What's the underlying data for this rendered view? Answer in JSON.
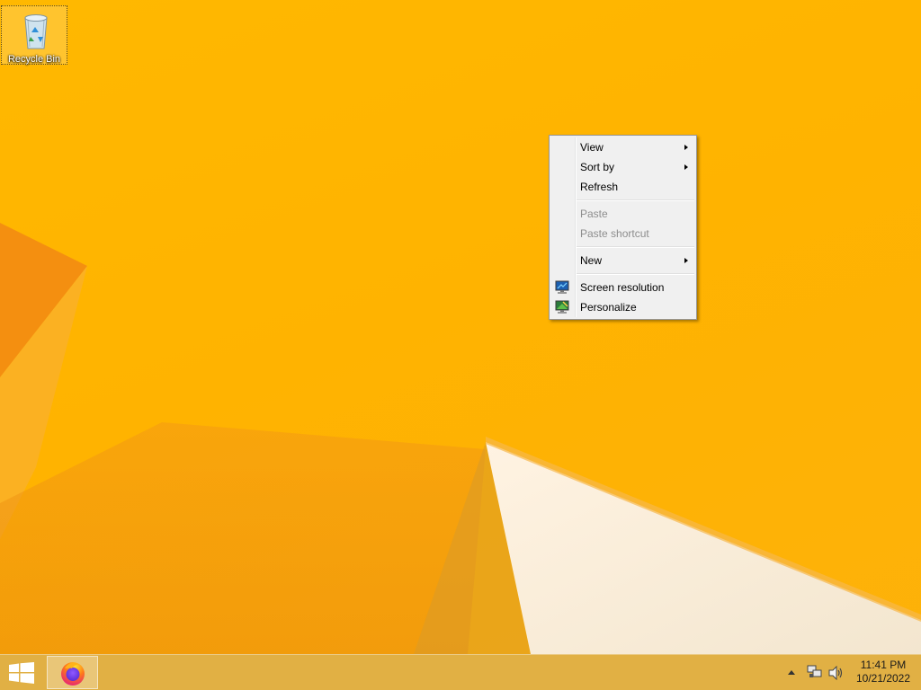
{
  "desktop": {
    "icons": [
      {
        "label": "Recycle Bin",
        "icon": "recycle-bin-icon"
      }
    ]
  },
  "context_menu": {
    "items": [
      {
        "label": "View",
        "submenu": true,
        "enabled": true
      },
      {
        "label": "Sort by",
        "submenu": true,
        "enabled": true
      },
      {
        "label": "Refresh",
        "submenu": false,
        "enabled": true
      },
      {
        "label": "Paste",
        "submenu": false,
        "enabled": false
      },
      {
        "label": "Paste shortcut",
        "submenu": false,
        "enabled": false
      },
      {
        "label": "New",
        "submenu": true,
        "enabled": true
      },
      {
        "label": "Screen resolution",
        "submenu": false,
        "enabled": true,
        "icon": "screen-resolution-icon"
      },
      {
        "label": "Personalize",
        "submenu": false,
        "enabled": true,
        "icon": "personalize-icon"
      }
    ]
  },
  "taskbar": {
    "start_icon": "windows-logo-icon",
    "pinned": [
      {
        "name": "Firefox",
        "icon": "firefox-icon"
      }
    ],
    "tray": {
      "icons": [
        "show-hidden-icons-arrow",
        "network-icon",
        "volume-icon"
      ],
      "time": "11:41 PM",
      "date": "10/21/2022"
    }
  },
  "colors": {
    "wallpaper_base": "#ffb800",
    "wallpaper_shadow": "#f08a0a",
    "wallpaper_light": "#fbefd9",
    "taskbar": "#deb04a",
    "menu_bg": "#f0f0f0",
    "disabled_text": "#8d8d8d"
  }
}
